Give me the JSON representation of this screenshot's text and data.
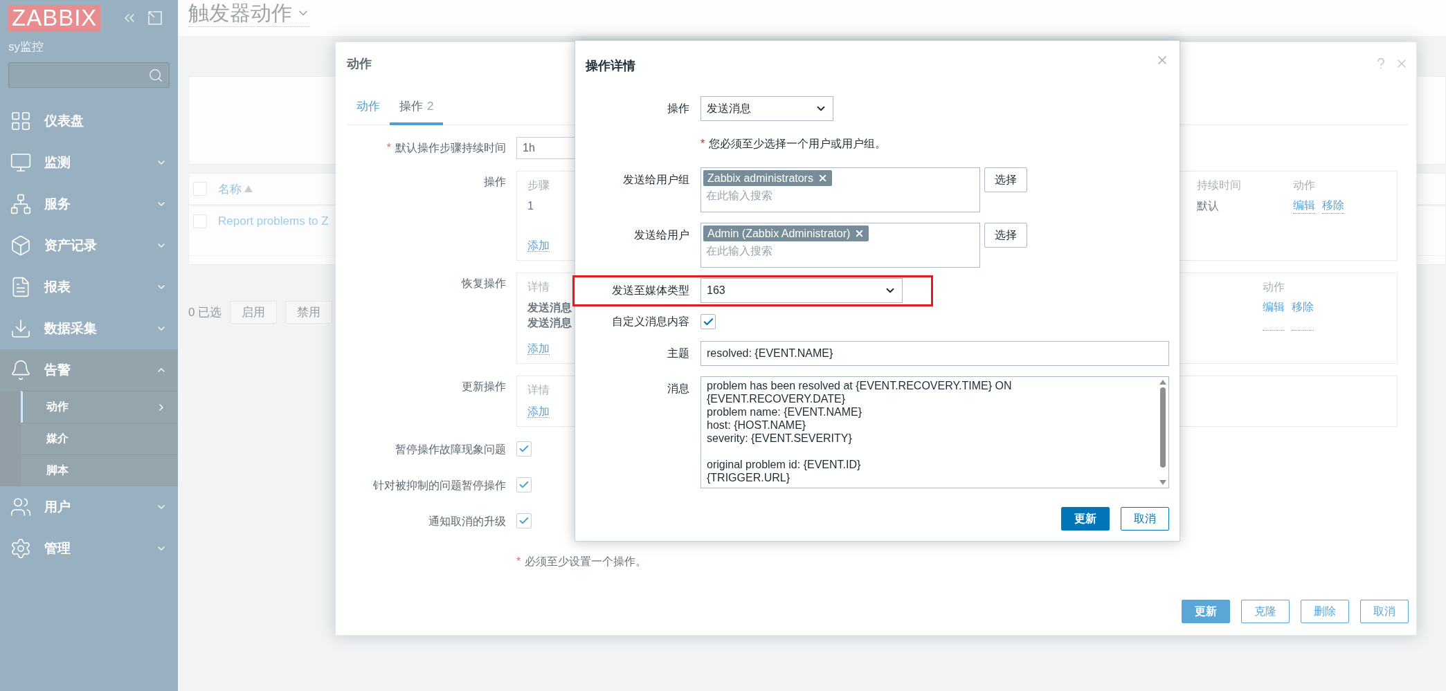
{
  "sidebar": {
    "logo": "ZABBIX",
    "server_name": "sy监控",
    "items": [
      {
        "label": "仪表盘",
        "kind": "link"
      },
      {
        "label": "监测",
        "kind": "group",
        "expanded": false
      },
      {
        "label": "服务",
        "kind": "group",
        "expanded": false
      },
      {
        "label": "资产记录",
        "kind": "group",
        "expanded": false
      },
      {
        "label": "报表",
        "kind": "group",
        "expanded": false
      },
      {
        "label": "数据采集",
        "kind": "group",
        "expanded": false
      },
      {
        "label": "告警",
        "kind": "group",
        "expanded": true,
        "children": [
          {
            "label": "动作",
            "selected": true
          },
          {
            "label": "媒介",
            "selected": false
          },
          {
            "label": "脚本",
            "selected": false
          }
        ]
      },
      {
        "label": "用户",
        "kind": "group",
        "expanded": false
      },
      {
        "label": "管理",
        "kind": "group",
        "expanded": false
      }
    ]
  },
  "page": {
    "title": "触发器动作",
    "table": {
      "select_all": {
        "checked": false
      },
      "columns": [
        "名称"
      ],
      "rows": [
        {
          "name": "Report problems to Z",
          "checked": false
        }
      ]
    },
    "selection_count": "0 已选",
    "mass_buttons": [
      "启用",
      "禁用"
    ]
  },
  "action_dialog": {
    "title": "动作",
    "tabs": [
      {
        "label": "动作",
        "selected": false
      },
      {
        "label": "操作",
        "count": "2",
        "selected": true
      }
    ],
    "duration": {
      "mark": "*",
      "label": "默认操作步骤持续时间",
      "value": "1h"
    },
    "operations": {
      "label": "操作",
      "columns": [
        "步骤",
        "持续时间",
        "动作"
      ],
      "rows": [
        {
          "step": "1",
          "duration": "默认",
          "actions": [
            "编辑",
            "移除"
          ]
        }
      ],
      "add": "添加"
    },
    "recovery_operations": {
      "label": "恢复操作",
      "columns": [
        "详情",
        "动作"
      ],
      "rows": [
        {
          "details": [
            "发送消息",
            "发送消息"
          ],
          "actions": [
            "编辑",
            "移除"
          ]
        }
      ],
      "add": "添加"
    },
    "update_operations": {
      "label": "更新操作",
      "columns": [
        "详情"
      ],
      "add": "添加"
    },
    "options": [
      {
        "label": "暂停操作故障现象问题",
        "checked": true
      },
      {
        "label": "针对被抑制的问题暂停操作",
        "checked": true
      },
      {
        "label": "通知取消的升级",
        "checked": true
      }
    ],
    "note": {
      "mark": "*",
      "text": "必须至少设置一个操作。"
    },
    "buttons": [
      {
        "label": "更新",
        "primary": true
      },
      {
        "label": "克隆",
        "primary": false
      },
      {
        "label": "删除",
        "primary": false
      },
      {
        "label": "取消",
        "primary": false
      }
    ]
  },
  "operation_dialog": {
    "title": "操作详情",
    "fields": [
      {
        "kind": "select",
        "label": "操作",
        "value": "发送消息"
      },
      {
        "kind": "note",
        "mark": "*",
        "text": "您必须至少选择一个用户或用户组。"
      },
      {
        "kind": "multiselect",
        "label": "发送给用户组",
        "tags": [
          "Zabbix administrators"
        ],
        "placeholder": "在此输入搜索",
        "button": "选择"
      },
      {
        "kind": "multiselect",
        "label": "发送给用户",
        "tags": [
          "Admin (Zabbix Administrator)"
        ],
        "placeholder": "在此输入搜索",
        "button": "选择"
      },
      {
        "kind": "select",
        "label": "发送至媒体类型",
        "value": "163",
        "highlighted": true
      },
      {
        "kind": "checkbox",
        "label": "自定义消息内容",
        "checked": true
      },
      {
        "kind": "input",
        "label": "主题",
        "value": "resolved: {EVENT.NAME}"
      },
      {
        "kind": "textarea",
        "label": "消息",
        "value": "problem has been resolved at {EVENT.RECOVERY.TIME} ON\n{EVENT.RECOVERY.DATE}\nproblem name: {EVENT.NAME}\nhost: {HOST.NAME}\nseverity: {EVENT.SEVERITY}\n\noriginal problem id: {EVENT.ID}\n{TRIGGER.URL}"
      }
    ],
    "buttons": [
      {
        "label": "更新",
        "primary": true
      },
      {
        "label": "取消",
        "primary": false
      }
    ]
  }
}
